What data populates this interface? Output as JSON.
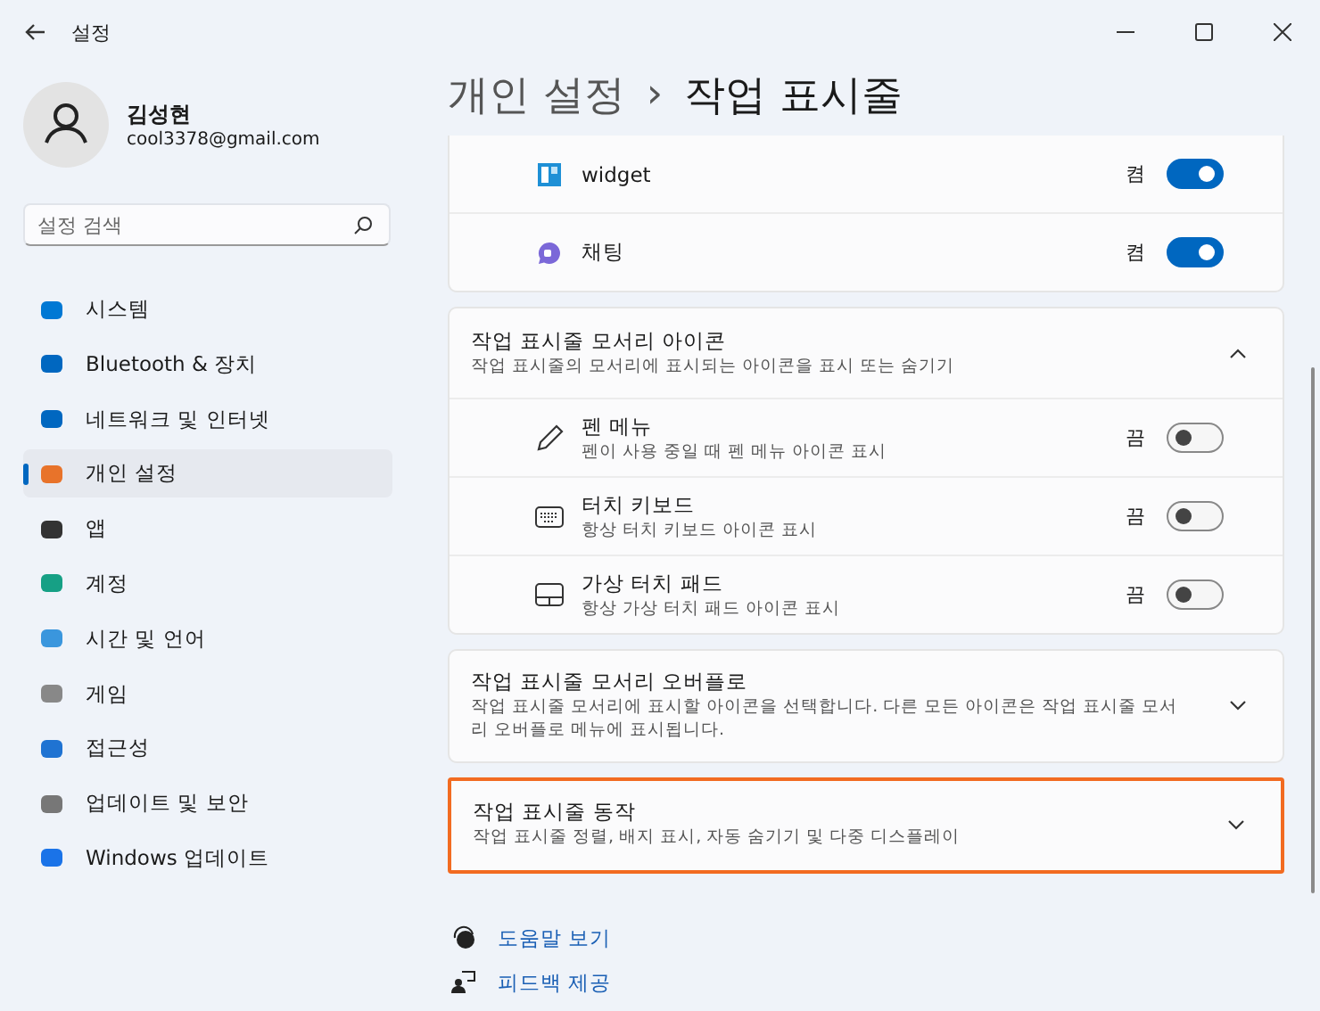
{
  "window": {
    "title": "설정"
  },
  "account": {
    "name": "김성현",
    "email": "cool3378@gmail.com"
  },
  "search": {
    "placeholder": "설정 검색"
  },
  "nav": [
    {
      "label": "시스템",
      "selected": false
    },
    {
      "label": "Bluetooth & 장치",
      "selected": false
    },
    {
      "label": "네트워크 및 인터넷",
      "selected": false
    },
    {
      "label": "개인 설정",
      "selected": true
    },
    {
      "label": "앱",
      "selected": false
    },
    {
      "label": "계정",
      "selected": false
    },
    {
      "label": "시간 및 언어",
      "selected": false
    },
    {
      "label": "게임",
      "selected": false
    },
    {
      "label": "접근성",
      "selected": false
    },
    {
      "label": "업데이트 및 보안",
      "selected": false
    },
    {
      "label": "Windows 업데이트",
      "selected": false
    }
  ],
  "breadcrumb": {
    "parent": "개인 설정",
    "separator": "›",
    "current": "작업 표시줄"
  },
  "sections": [
    {
      "highlighted": false,
      "items": [
        {
          "label": "widget",
          "state": "켬",
          "on": true
        },
        {
          "label": "채팅",
          "state": "켬",
          "on": true
        }
      ]
    },
    {
      "title": "작업 표시줄 모서리 아이콘",
      "description": "작업 표시줄의 모서리에 표시되는 아이콘을 표시 또는 숨기기",
      "expanded": true,
      "highlighted": false,
      "items": [
        {
          "label": "펜 메뉴",
          "description": "펜이 사용 중일 때 펜 메뉴 아이콘 표시",
          "state": "끔",
          "on": false
        },
        {
          "label": "터치 키보드",
          "description": "항상 터치 키보드 아이콘 표시",
          "state": "끔",
          "on": false
        },
        {
          "label": "가상 터치 패드",
          "description": "항상 가상 터치 패드 아이콘 표시",
          "state": "끔",
          "on": false
        }
      ]
    },
    {
      "title": "작업 표시줄 모서리 오버플로",
      "description": "작업 표시줄 모서리에 표시할 아이콘을 선택합니다. 다른 모든 아이콘은 작업 표시줄 모서리 오버플로 메뉴에 표시됩니다.",
      "expanded": false,
      "highlighted": false
    },
    {
      "title": "작업 표시줄 동작",
      "description": "작업 표시줄 정렬, 배지 표시, 자동 숨기기 및 다중 디스플레이",
      "expanded": false,
      "highlighted": true
    }
  ],
  "links": [
    {
      "label": "도움말 보기"
    },
    {
      "label": "피드백 제공"
    }
  ]
}
